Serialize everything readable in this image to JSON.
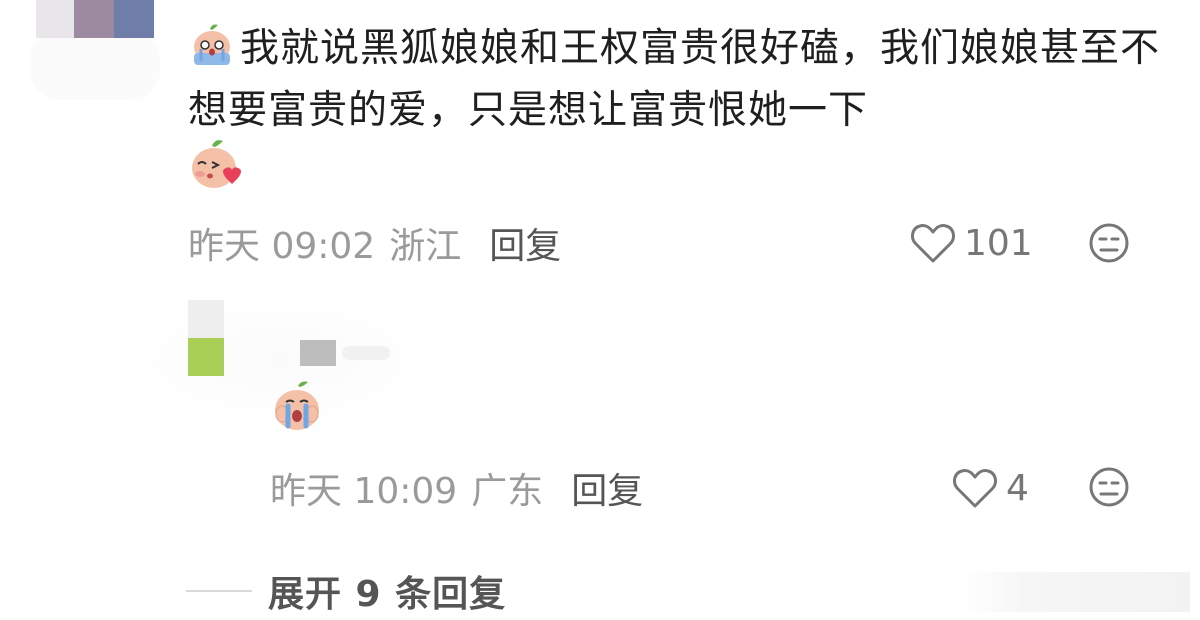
{
  "comment": {
    "text": "我就说黑狐娘娘和王权富贵很好磕，我们娘娘甚至不想要富贵的爱，只是想让富贵恨她一下",
    "time": "昨天 09:02",
    "location": "浙江",
    "reply_label": "回复",
    "likes": "101",
    "emojis": [
      "crying-peach-emoji",
      "kiss-heart-peach-emoji"
    ]
  },
  "reply": {
    "time": "昨天 10:09",
    "location": "广东",
    "reply_label": "回复",
    "likes": "4",
    "emojis": [
      "crying-peach-emoji"
    ]
  },
  "expand": {
    "label": "展开 9 条回复"
  },
  "colors": {
    "meta_text": "#9a9a9a",
    "reply_button": "#555555",
    "comment_text": "#1f1f1f",
    "peach": "#f5c0a8",
    "leaf": "#6ab04c",
    "tears": "#8fb8e8",
    "heart": "#e8405a"
  },
  "icons": [
    "heart-outline-icon",
    "neutral-face-icon"
  ]
}
